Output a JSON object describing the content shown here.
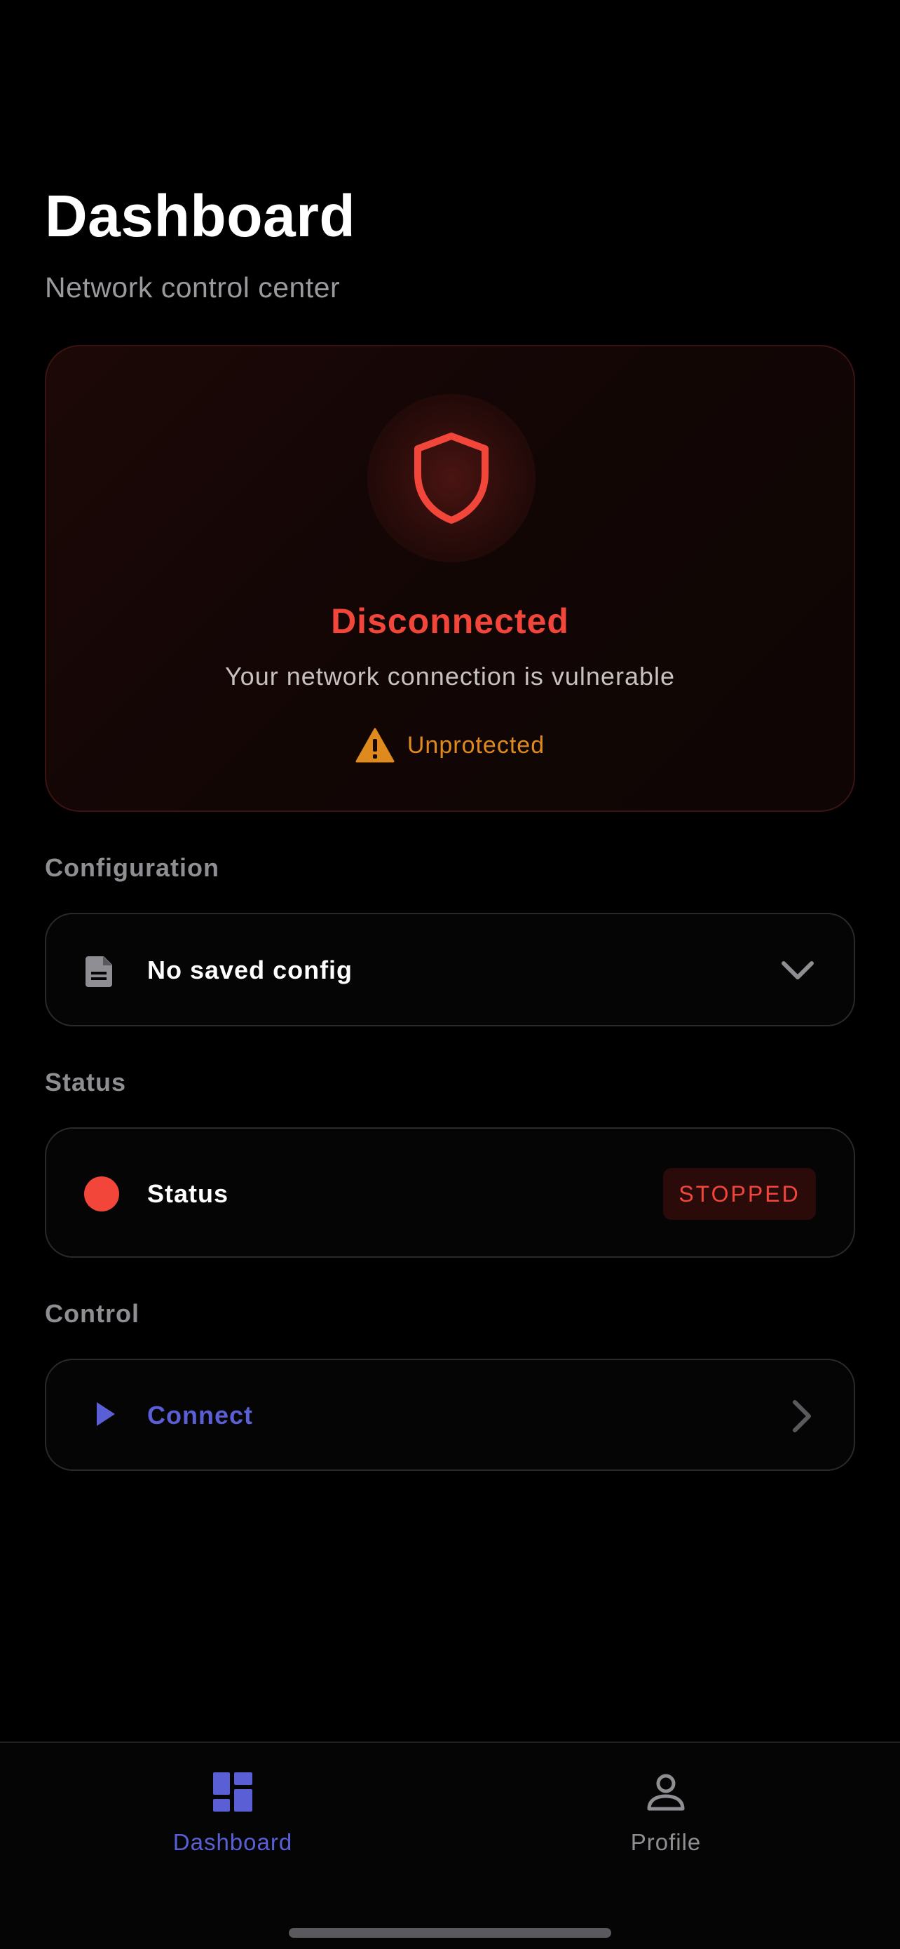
{
  "header": {
    "title": "Dashboard",
    "subtitle": "Network control center"
  },
  "hero": {
    "state": "Disconnected",
    "message": "Your network connection is vulnerable",
    "badge": "Unprotected",
    "icon": "shield-icon",
    "badge_icon": "warning-icon"
  },
  "configuration": {
    "section_title": "Configuration",
    "value": "No saved config",
    "icon": "document-icon"
  },
  "status": {
    "section_title": "Status",
    "label": "Status",
    "badge": "STOPPED"
  },
  "control": {
    "section_title": "Control",
    "label": "Connect",
    "icon": "play-icon"
  },
  "tabbar": {
    "tabs": [
      {
        "label": "Dashboard",
        "icon": "dashboard-icon",
        "active": true
      },
      {
        "label": "Profile",
        "icon": "person-icon",
        "active": false
      }
    ]
  },
  "colors": {
    "background": "#000000",
    "danger": "#f2463b",
    "warning": "#df8a1e",
    "accent": "#5b5fd6",
    "muted": "#8e8e93"
  }
}
